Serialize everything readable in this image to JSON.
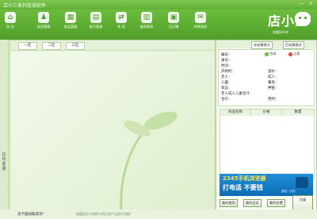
{
  "window": {
    "title": "店小三系列连锁软件",
    "minimize": "—",
    "close": "×"
  },
  "toolbar": {
    "items": [
      {
        "label": "前 台",
        "icon": "home-icon",
        "glyph": "⌂"
      },
      {
        "label": "会员管理",
        "icon": "users-icon",
        "glyph": "♟"
      },
      {
        "label": "商品管理",
        "icon": "store-icon",
        "glyph": "▦"
      },
      {
        "label": "账号管理",
        "icon": "account-book-icon",
        "glyph": "▤"
      },
      {
        "label": "交 班",
        "icon": "handover-icon",
        "glyph": "⇄"
      },
      {
        "label": "查询报表",
        "icon": "report-icon",
        "glyph": "▥"
      },
      {
        "label": "日记簿",
        "icon": "calendar-icon",
        "glyph": "▣"
      },
      {
        "label": "特殊描述",
        "icon": "gift-icon",
        "glyph": "✉"
      }
    ]
  },
  "logo": {
    "text": "店小三",
    "subtitle": "加盟好伙伴"
  },
  "leftstrip": {
    "label": "在线客服"
  },
  "tabs": [
    "一区",
    "二区",
    "三区"
  ],
  "footer": {
    "status": "读卡器加载成功！",
    "hint": "加盟会员卡和刷卡机已经产品部分功能！"
  },
  "mode": {
    "first_pay": "先结算模式",
    "later_pay": "后结算模式"
  },
  "legend": {
    "free": "空闲",
    "busy": "占用"
  },
  "info_fields": {
    "number": "编号：",
    "table_no": "桌号：",
    "time": "时间：",
    "start": "开始时：",
    "elder": "老人：",
    "child": "儿童：",
    "status": "状态：",
    "remark": "老人成人儿童合计：",
    "total": "合计：",
    "wine": "酒水：",
    "adult": "成人：",
    "meal": "餐具：",
    "deposit": "押金：",
    "usedtime": "用时："
  },
  "table": {
    "columns": [
      "商品名称",
      "价格",
      "数量"
    ]
  },
  "ad": {
    "line1": "2345手机浏览器",
    "line2": "打电话 不要钱",
    "line3": "通话一分钟"
  },
  "buttons": {
    "temp_order": "临时使用",
    "temp_card": "临时会员",
    "temp_pay": "临时交费",
    "main": "对桌"
  },
  "colors": {
    "brand_green": "#5fae35",
    "free_dot": "#5fae35",
    "busy_dot": "#e03c2f",
    "ad_blue": "#1e8fd6"
  }
}
